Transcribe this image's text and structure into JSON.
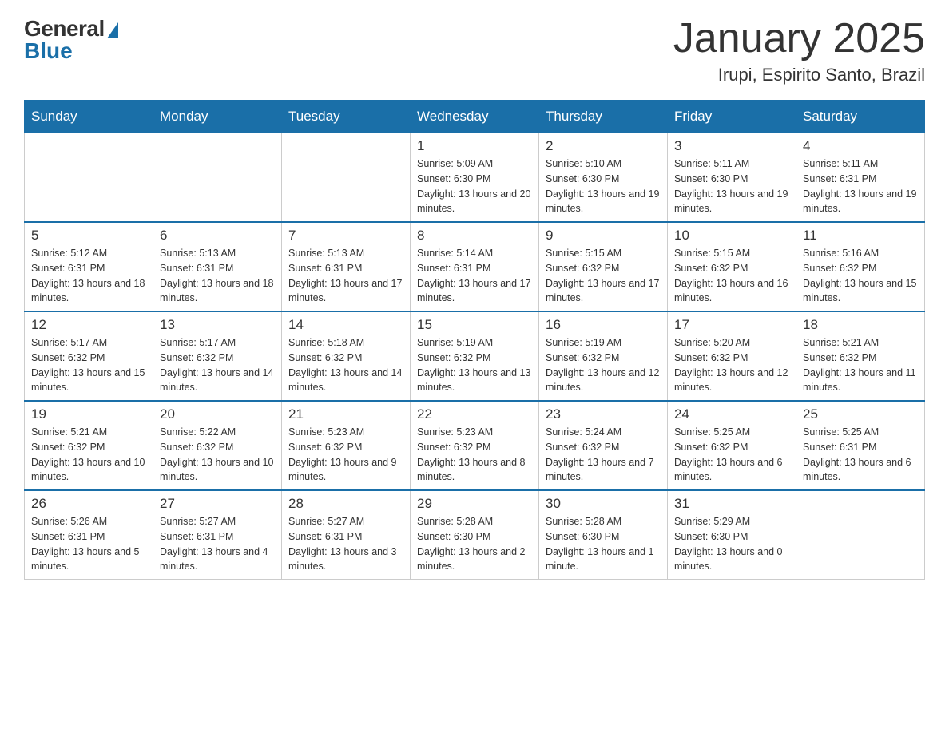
{
  "logo": {
    "general": "General",
    "blue": "Blue"
  },
  "title": "January 2025",
  "subtitle": "Irupi, Espirito Santo, Brazil",
  "days_of_week": [
    "Sunday",
    "Monday",
    "Tuesday",
    "Wednesday",
    "Thursday",
    "Friday",
    "Saturday"
  ],
  "weeks": [
    [
      {
        "day": "",
        "info": ""
      },
      {
        "day": "",
        "info": ""
      },
      {
        "day": "",
        "info": ""
      },
      {
        "day": "1",
        "info": "Sunrise: 5:09 AM\nSunset: 6:30 PM\nDaylight: 13 hours and 20 minutes."
      },
      {
        "day": "2",
        "info": "Sunrise: 5:10 AM\nSunset: 6:30 PM\nDaylight: 13 hours and 19 minutes."
      },
      {
        "day": "3",
        "info": "Sunrise: 5:11 AM\nSunset: 6:30 PM\nDaylight: 13 hours and 19 minutes."
      },
      {
        "day": "4",
        "info": "Sunrise: 5:11 AM\nSunset: 6:31 PM\nDaylight: 13 hours and 19 minutes."
      }
    ],
    [
      {
        "day": "5",
        "info": "Sunrise: 5:12 AM\nSunset: 6:31 PM\nDaylight: 13 hours and 18 minutes."
      },
      {
        "day": "6",
        "info": "Sunrise: 5:13 AM\nSunset: 6:31 PM\nDaylight: 13 hours and 18 minutes."
      },
      {
        "day": "7",
        "info": "Sunrise: 5:13 AM\nSunset: 6:31 PM\nDaylight: 13 hours and 17 minutes."
      },
      {
        "day": "8",
        "info": "Sunrise: 5:14 AM\nSunset: 6:31 PM\nDaylight: 13 hours and 17 minutes."
      },
      {
        "day": "9",
        "info": "Sunrise: 5:15 AM\nSunset: 6:32 PM\nDaylight: 13 hours and 17 minutes."
      },
      {
        "day": "10",
        "info": "Sunrise: 5:15 AM\nSunset: 6:32 PM\nDaylight: 13 hours and 16 minutes."
      },
      {
        "day": "11",
        "info": "Sunrise: 5:16 AM\nSunset: 6:32 PM\nDaylight: 13 hours and 15 minutes."
      }
    ],
    [
      {
        "day": "12",
        "info": "Sunrise: 5:17 AM\nSunset: 6:32 PM\nDaylight: 13 hours and 15 minutes."
      },
      {
        "day": "13",
        "info": "Sunrise: 5:17 AM\nSunset: 6:32 PM\nDaylight: 13 hours and 14 minutes."
      },
      {
        "day": "14",
        "info": "Sunrise: 5:18 AM\nSunset: 6:32 PM\nDaylight: 13 hours and 14 minutes."
      },
      {
        "day": "15",
        "info": "Sunrise: 5:19 AM\nSunset: 6:32 PM\nDaylight: 13 hours and 13 minutes."
      },
      {
        "day": "16",
        "info": "Sunrise: 5:19 AM\nSunset: 6:32 PM\nDaylight: 13 hours and 12 minutes."
      },
      {
        "day": "17",
        "info": "Sunrise: 5:20 AM\nSunset: 6:32 PM\nDaylight: 13 hours and 12 minutes."
      },
      {
        "day": "18",
        "info": "Sunrise: 5:21 AM\nSunset: 6:32 PM\nDaylight: 13 hours and 11 minutes."
      }
    ],
    [
      {
        "day": "19",
        "info": "Sunrise: 5:21 AM\nSunset: 6:32 PM\nDaylight: 13 hours and 10 minutes."
      },
      {
        "day": "20",
        "info": "Sunrise: 5:22 AM\nSunset: 6:32 PM\nDaylight: 13 hours and 10 minutes."
      },
      {
        "day": "21",
        "info": "Sunrise: 5:23 AM\nSunset: 6:32 PM\nDaylight: 13 hours and 9 minutes."
      },
      {
        "day": "22",
        "info": "Sunrise: 5:23 AM\nSunset: 6:32 PM\nDaylight: 13 hours and 8 minutes."
      },
      {
        "day": "23",
        "info": "Sunrise: 5:24 AM\nSunset: 6:32 PM\nDaylight: 13 hours and 7 minutes."
      },
      {
        "day": "24",
        "info": "Sunrise: 5:25 AM\nSunset: 6:32 PM\nDaylight: 13 hours and 6 minutes."
      },
      {
        "day": "25",
        "info": "Sunrise: 5:25 AM\nSunset: 6:31 PM\nDaylight: 13 hours and 6 minutes."
      }
    ],
    [
      {
        "day": "26",
        "info": "Sunrise: 5:26 AM\nSunset: 6:31 PM\nDaylight: 13 hours and 5 minutes."
      },
      {
        "day": "27",
        "info": "Sunrise: 5:27 AM\nSunset: 6:31 PM\nDaylight: 13 hours and 4 minutes."
      },
      {
        "day": "28",
        "info": "Sunrise: 5:27 AM\nSunset: 6:31 PM\nDaylight: 13 hours and 3 minutes."
      },
      {
        "day": "29",
        "info": "Sunrise: 5:28 AM\nSunset: 6:30 PM\nDaylight: 13 hours and 2 minutes."
      },
      {
        "day": "30",
        "info": "Sunrise: 5:28 AM\nSunset: 6:30 PM\nDaylight: 13 hours and 1 minute."
      },
      {
        "day": "31",
        "info": "Sunrise: 5:29 AM\nSunset: 6:30 PM\nDaylight: 13 hours and 0 minutes."
      },
      {
        "day": "",
        "info": ""
      }
    ]
  ]
}
